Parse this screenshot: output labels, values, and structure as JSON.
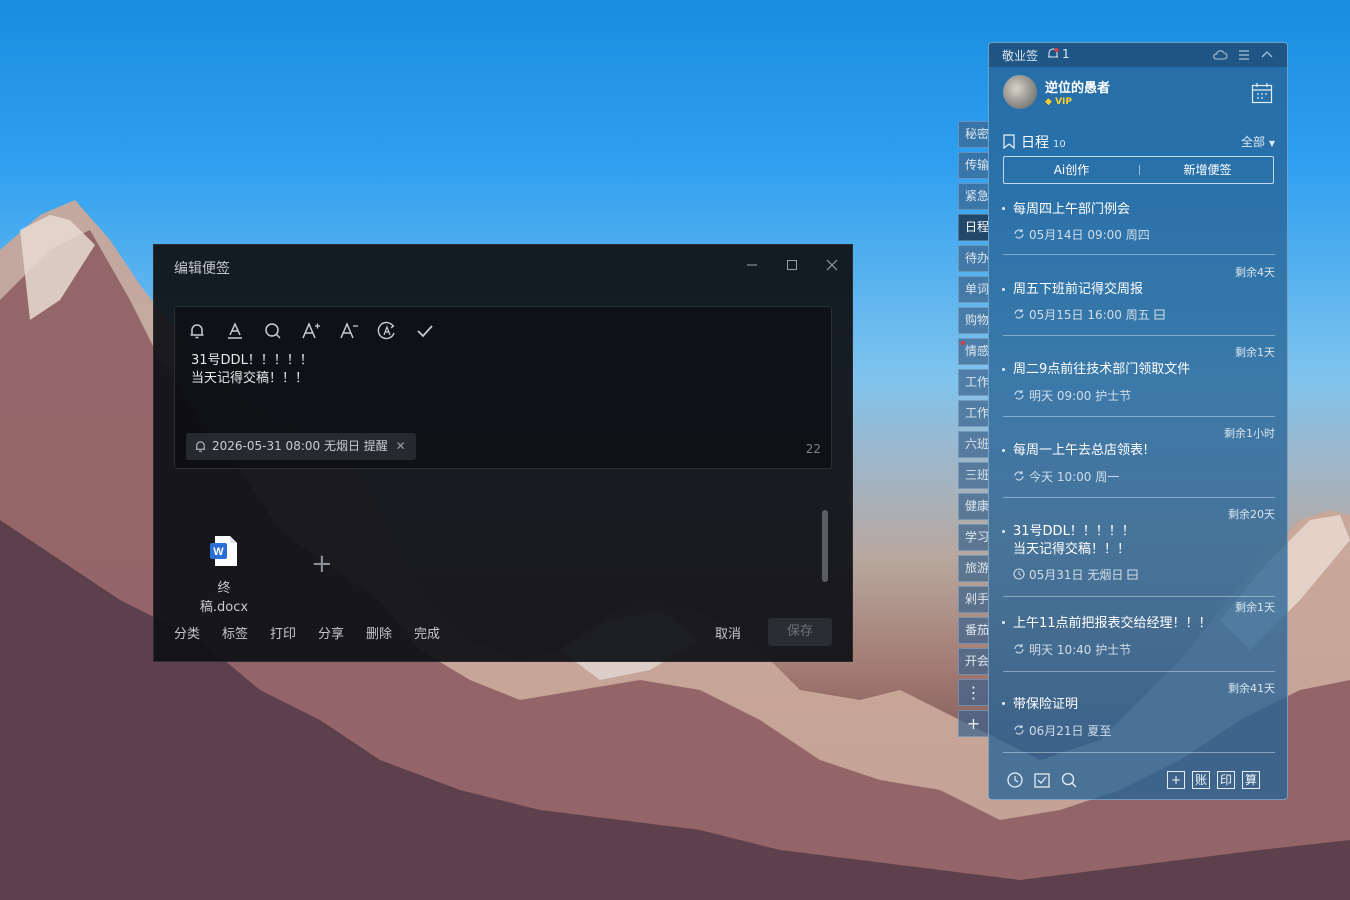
{
  "editor": {
    "title": "编辑便签",
    "window_controls": [
      "minimize-icon",
      "maximize-icon",
      "close-icon"
    ],
    "toolbar_icons": [
      "bell-icon",
      "font-color-icon",
      "search-icon",
      "font-increase-icon",
      "font-decrease-icon",
      "text-ai-icon",
      "check-icon"
    ],
    "content_line1": "31号DDL！！！！！",
    "content_line2": "当天记得交稿！！！",
    "reminder_text": "2026-05-31 08:00 无烟日 提醒",
    "char_count": "22",
    "attachment_name": "终稿.docx",
    "bottom_actions": [
      "分类",
      "标签",
      "打印",
      "分享",
      "删除",
      "完成"
    ],
    "cancel_label": "取消",
    "save_label": "保存"
  },
  "side_tabs": [
    "秘密",
    "传输",
    "紧急",
    "日程",
    "待办",
    "单词",
    "购物",
    "情感",
    "工作",
    "工作",
    "六班",
    "三班",
    "健康",
    "学习",
    "旅游",
    "剁手",
    "番茄",
    "开会"
  ],
  "side_tab_active": "日程",
  "panel": {
    "app_title": "敬业签",
    "notification_count": "1",
    "username": "逆位的愚者",
    "vip_label": "VIP",
    "schedule_title": "日程",
    "schedule_count": "10",
    "filter_label": "全部",
    "ai_create_label": "Ai创作",
    "new_note_label": "新增便签",
    "items": [
      {
        "remain": "",
        "title": "每周四上午部门例会",
        "title2": "",
        "meta": "05月14日 09:00 周四",
        "meta_icon": "repeat-icon",
        "extra_icon": ""
      },
      {
        "remain": "剩余4天",
        "title": "周五下班前记得交周报",
        "title2": "",
        "meta": "05月15日 16:00 周五",
        "meta_icon": "repeat-icon",
        "extra_icon": "attachment-icon"
      },
      {
        "remain": "剩余1天",
        "title": "周二9点前往技术部门领取文件",
        "title2": "",
        "meta": "明天 09:00 护士节",
        "meta_icon": "repeat-icon",
        "extra_icon": ""
      },
      {
        "remain": "剩余1小时",
        "title": "每周一上午去总店领表!",
        "title2": "",
        "meta": "今天 10:00 周一",
        "meta_icon": "repeat-icon",
        "extra_icon": ""
      },
      {
        "remain": "剩余20天",
        "title": "31号DDL！！！！！",
        "title2": "当天记得交稿！！！",
        "meta": "05月31日 无烟日",
        "meta_icon": "clock-icon",
        "extra_icon": "attachment-icon"
      },
      {
        "remain": "剩余1天",
        "title": "上午11点前把报表交给经理！！！",
        "title2": "",
        "meta": "明天 10:40 护士节",
        "meta_icon": "repeat-icon",
        "extra_icon": ""
      },
      {
        "remain": "剩余41天",
        "title": "带保险证明",
        "title2": "",
        "meta": "06月21日 夏至",
        "meta_icon": "repeat-icon",
        "extra_icon": ""
      }
    ],
    "bottom_boxes": [
      "+",
      "账",
      "印",
      "算"
    ]
  },
  "colors": {
    "panel_bg": "#2864966e",
    "editor_bg": "#0e1014",
    "vip": "#ffd02b",
    "notif_dot": "#e0393e"
  }
}
